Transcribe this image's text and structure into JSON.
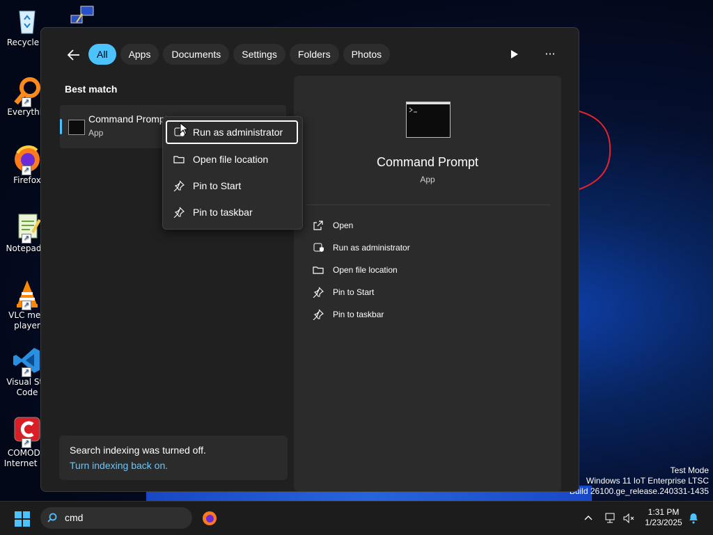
{
  "desktop": {
    "icons": [
      {
        "label": "Recycle B",
        "icon": "recycle-bin-icon"
      },
      {
        "label": "Everythin",
        "icon": "everything-icon"
      },
      {
        "label": "Firefox",
        "icon": "firefox-icon"
      },
      {
        "label": "Notepad+",
        "icon": "notepad-plus-icon"
      },
      {
        "label": "VLC med\nplayer",
        "icon": "vlc-icon"
      },
      {
        "label": "Visual Stu\nCode",
        "icon": "vscode-icon"
      },
      {
        "label": "COMODO\nInternet Se",
        "icon": "comodo-icon"
      }
    ],
    "watermark": [
      "Test Mode",
      "Windows 11 IoT Enterprise LTSC",
      "Build 26100.ge_release.240331-1435"
    ]
  },
  "search_panel": {
    "tabs": [
      {
        "label": "All",
        "active": true
      },
      {
        "label": "Apps",
        "active": false
      },
      {
        "label": "Documents",
        "active": false
      },
      {
        "label": "Settings",
        "active": false
      },
      {
        "label": "Folders",
        "active": false
      },
      {
        "label": "Photos",
        "active": false
      }
    ],
    "best_match_title": "Best match",
    "result": {
      "name": "Command Prompt",
      "type": "App"
    },
    "notice": {
      "text": "Search indexing was turned off.",
      "link": "Turn indexing back on."
    },
    "detail": {
      "name": "Command Prompt",
      "type": "App",
      "actions": [
        "Open",
        "Run as administrator",
        "Open file location",
        "Pin to Start",
        "Pin to taskbar"
      ]
    }
  },
  "context_menu": {
    "items": [
      "Run as administrator",
      "Open file location",
      "Pin to Start",
      "Pin to taskbar"
    ],
    "focused_index": 0
  },
  "taskbar": {
    "search_text": "cmd",
    "time": "1:31 PM",
    "date": "1/23/2025"
  },
  "colors": {
    "accent": "#4cc2ff",
    "link": "#64c8ff",
    "panel": "#202020"
  }
}
